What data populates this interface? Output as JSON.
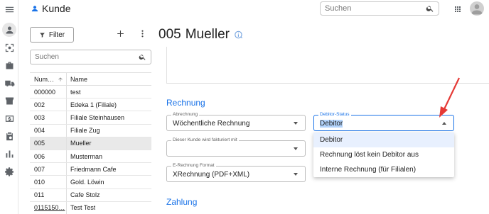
{
  "header": {
    "title": "Kunde",
    "search_placeholder": "Suchen"
  },
  "rail": {
    "icons": [
      "menu-icon",
      "person-icon",
      "scan-icon",
      "briefcase-icon",
      "truck-icon",
      "store-icon",
      "dollar-icon",
      "clipboard-icon",
      "bar-chart-icon",
      "settings-icon"
    ]
  },
  "panel": {
    "filter_label": "Filter",
    "search_placeholder": "Suchen",
    "columns": [
      "Num…",
      "Name"
    ],
    "rows": [
      {
        "num": "000000",
        "name": "test"
      },
      {
        "num": "002",
        "name": "Edeka 1 (Filiale)"
      },
      {
        "num": "003",
        "name": "Filiale Steinhausen"
      },
      {
        "num": "004",
        "name": "Filiale Zug"
      },
      {
        "num": "005",
        "name": "Mueller"
      },
      {
        "num": "006",
        "name": "Musterman"
      },
      {
        "num": "007",
        "name": "Friedmann Cafe"
      },
      {
        "num": "010",
        "name": "Gold. Löwin"
      },
      {
        "num": "011",
        "name": "Cafe Stolz"
      },
      {
        "num": "0115150…",
        "name": "Test Test"
      }
    ],
    "selected_row": "005"
  },
  "main": {
    "number": "005",
    "name": "Mueller",
    "section_rechnung": "Rechnung",
    "section_zahlung": "Zahlung",
    "abrechnung": {
      "label": "Abrechnung",
      "value": "Wöchentliche Rechnung"
    },
    "fakturiert": {
      "label": "Dieser Kunde wird fakturiert mit",
      "value": ""
    },
    "erechnung": {
      "label": "E-Rechnung Format",
      "value": "XRechnung (PDF+XML)"
    },
    "debitor_status": {
      "label": "Debitor-Status",
      "value": "Debitor"
    },
    "dropdown_options": [
      "Debitor",
      "Rechnung löst kein Debitor aus",
      "Interne Rechnung (für Filialen)"
    ]
  },
  "colors": {
    "accent": "#1a73e8",
    "annotation_arrow": "#e53935"
  }
}
